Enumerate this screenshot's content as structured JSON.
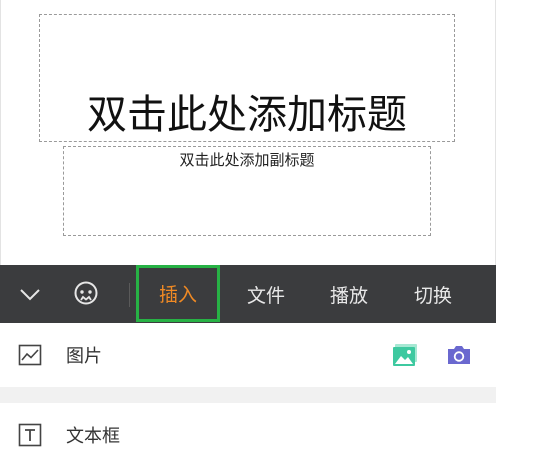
{
  "slide": {
    "title_placeholder": "双击此处添加标题",
    "subtitle_placeholder": "双击此处添加副标题"
  },
  "toolbar": {
    "tabs": [
      {
        "label": "插入",
        "selected": true
      },
      {
        "label": "文件",
        "selected": false
      },
      {
        "label": "播放",
        "selected": false
      },
      {
        "label": "切换",
        "selected": false
      }
    ],
    "icons": [
      "chevron-down-icon",
      "assistant-face-icon"
    ]
  },
  "menu": {
    "items": [
      {
        "label": "图片",
        "icon": "image-icon",
        "actions": [
          "gallery-icon",
          "camera-icon"
        ]
      },
      {
        "label": "文本框",
        "icon": "textbox-icon"
      }
    ]
  },
  "colors": {
    "toolbar_bg": "#3b3c3e",
    "selected_tab_text": "#f08a24",
    "selected_tab_border": "#27b245",
    "gallery_icon": "#3ec9a0",
    "camera_icon": "#6a68cf"
  }
}
